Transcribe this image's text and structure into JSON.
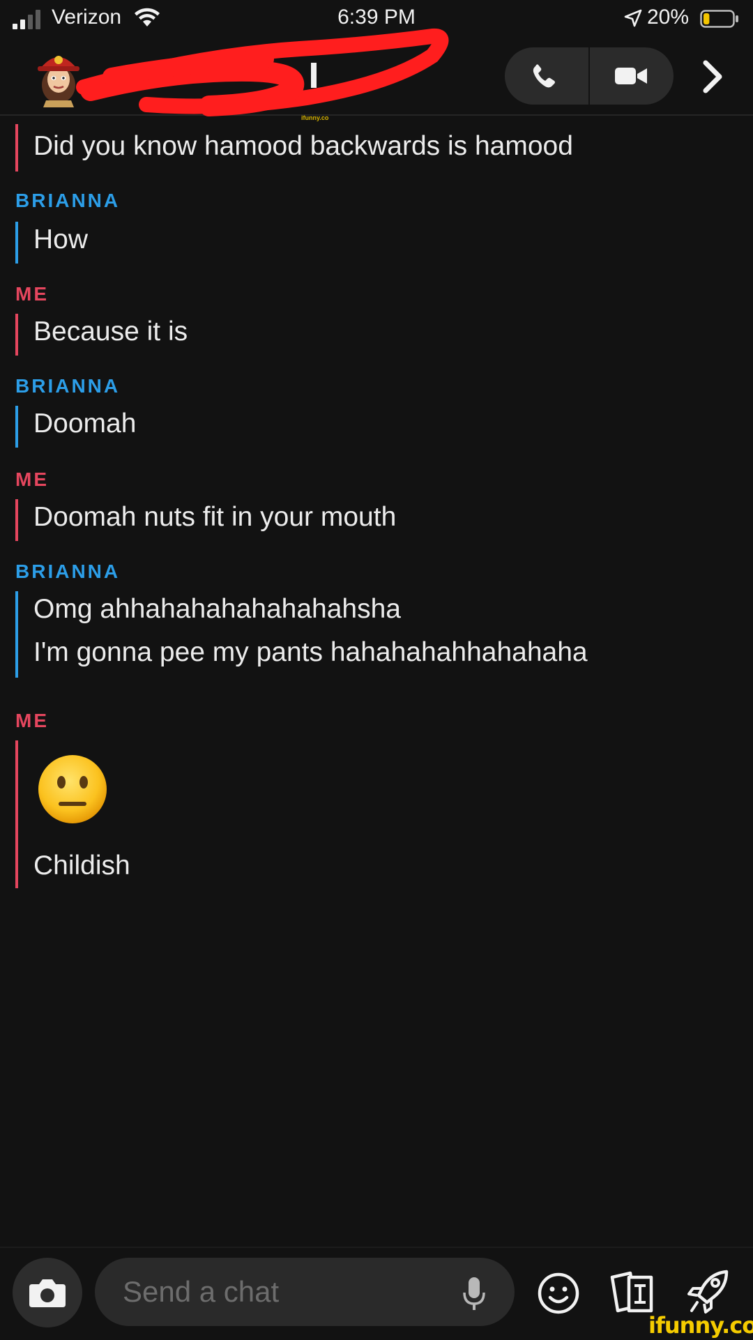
{
  "status_bar": {
    "carrier": "Verizon",
    "time": "6:39 PM",
    "battery_percent": "20%",
    "battery_level": 0.2,
    "icons": [
      "signal-icon",
      "wifi-icon",
      "location-arrow-icon",
      "battery-icon"
    ]
  },
  "header": {
    "icons": [
      "bitmoji-avatar",
      "phone-icon",
      "video-camera-icon",
      "chevron-right-icon"
    ]
  },
  "messages": [
    {
      "sender": "",
      "lines": [
        "Did you know hamood backwards is hamood"
      ]
    },
    {
      "sender": "BRIANNA",
      "lines": [
        "How"
      ]
    },
    {
      "sender": "ME",
      "lines": [
        "Because it is"
      ]
    },
    {
      "sender": "BRIANNA",
      "lines": [
        "Doomah"
      ]
    },
    {
      "sender": "ME",
      "lines": [
        "Doomah nuts fit in your mouth"
      ]
    },
    {
      "sender": "BRIANNA",
      "lines": [
        "Omg ahhahahahahahahahsha",
        "I'm gonna pee my pants hahahahahhahahaha"
      ]
    },
    {
      "sender": "ME",
      "lines": [
        "Childish"
      ],
      "emoji": "neutral-face-emoji"
    }
  ],
  "composer": {
    "placeholder": "Send a chat",
    "icons": [
      "camera-icon",
      "microphone-icon",
      "smiley-icon",
      "cards-icon",
      "rocket-icon"
    ]
  },
  "watermark": {
    "small": "ifunny.co",
    "large": "ifunny.co"
  },
  "colors": {
    "background": "#121212",
    "me": "#e5465e",
    "friend": "#2c9ee8",
    "watermark": "#f5cc00"
  }
}
